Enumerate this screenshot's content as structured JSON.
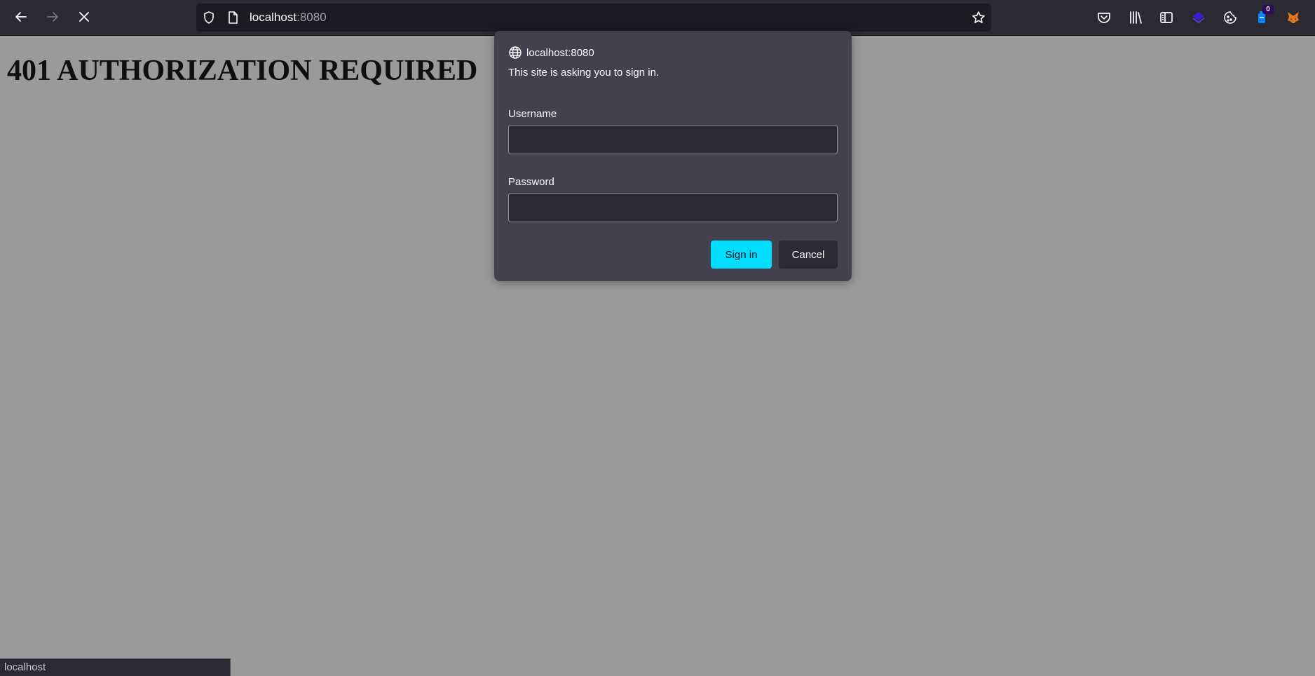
{
  "browser": {
    "url_host": "localhost",
    "url_port": ":8080",
    "badge_count": "0",
    "status_text": "localhost"
  },
  "page": {
    "heading": "401 AUTHORIZATION REQUIRED"
  },
  "dialog": {
    "host": "localhost:8080",
    "message": "This site is asking you to sign in.",
    "username_label": "Username",
    "username_value": "",
    "password_label": "Password",
    "password_value": "",
    "sign_in_label": "Sign in",
    "cancel_label": "Cancel"
  },
  "colors": {
    "accent": "#00ddff",
    "toolbar": "#2b2a33",
    "dialog": "#42414d",
    "page_overlay": "#9a9a9b"
  }
}
